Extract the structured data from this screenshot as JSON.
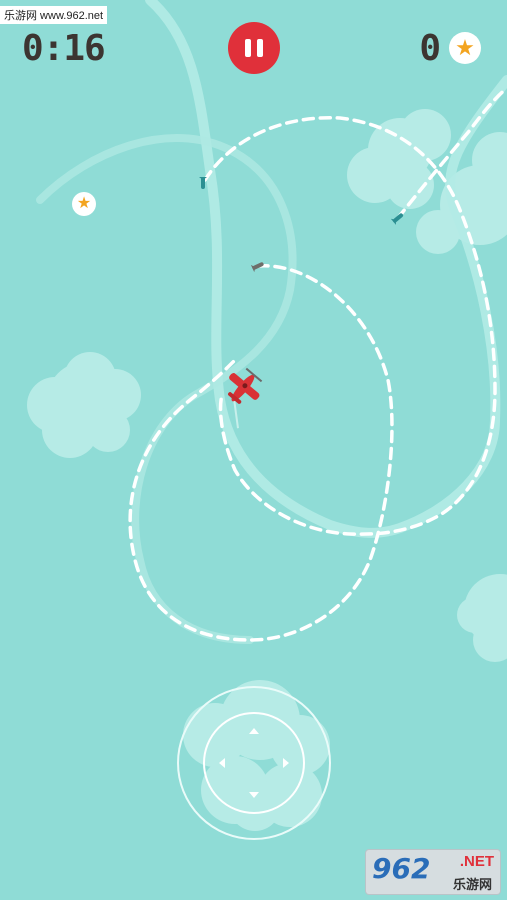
{
  "hud": {
    "timer": "0:16",
    "score": "0",
    "pause_icon": "pause-icon",
    "star_icon": "star-icon"
  },
  "colors": {
    "sky": "#8fdcd6",
    "pause": "#e0303a",
    "star": "#f3a420",
    "plane": "#d93236",
    "text": "#3c3531"
  },
  "watermark": {
    "top": "乐游网 www.962.net",
    "logo_num": "962",
    "logo_net": ".NET",
    "logo_cn": "乐游网"
  },
  "pickups": {
    "star": "★"
  },
  "joystick": {
    "icon": "joystick-icon"
  }
}
